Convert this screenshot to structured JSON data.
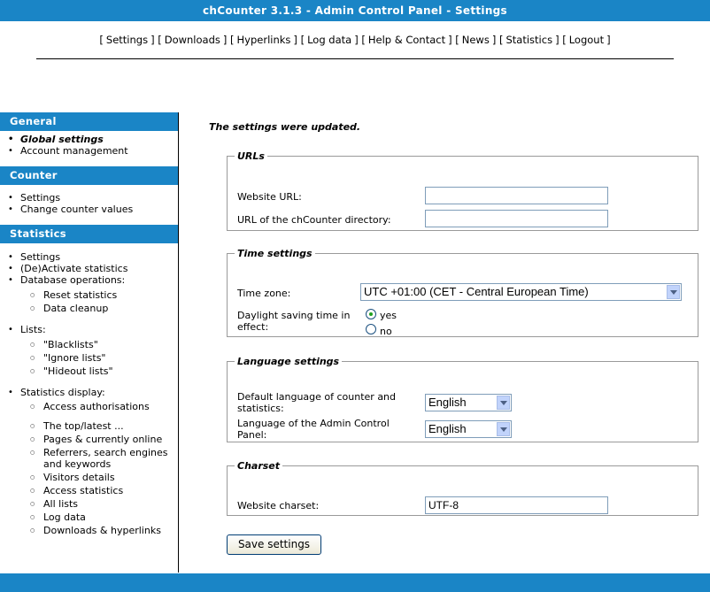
{
  "title": "chCounter 3.1.3 - Admin Control Panel - Settings",
  "topnav": [
    "Settings",
    "Downloads",
    "Hyperlinks",
    "Log data",
    "Help & Contact",
    "News",
    "Statistics",
    "Logout"
  ],
  "sidebar": {
    "general": {
      "title": "General",
      "items": [
        "Global settings",
        "Account management"
      ]
    },
    "counter": {
      "title": "Counter",
      "items": [
        "Settings",
        "Change counter values"
      ]
    },
    "statistics": {
      "title": "Statistics",
      "items": [
        "Settings",
        "(De)Activate statistics",
        "Database operations:"
      ],
      "dbops": [
        "Reset statistics",
        "Data cleanup"
      ],
      "lists_label": "Lists:",
      "lists": [
        "\"Blacklists\"",
        "\"Ignore lists\"",
        "\"Hideout lists\""
      ],
      "display_label": "Statistics display:",
      "display_auth": "Access authorisations",
      "display": [
        "The top/latest ...",
        "Pages & currently online",
        "Referrers, search engines and keywords",
        "Visitors details",
        "Access statistics",
        "All lists",
        "Log data",
        "Downloads & hyperlinks"
      ]
    }
  },
  "message": "The settings were updated.",
  "urls": {
    "legend": "URLs",
    "website_label": "Website URL:",
    "website_value": "",
    "dir_label": "URL of the chCounter directory:",
    "dir_value": ""
  },
  "time": {
    "legend": "Time settings",
    "tz_label": "Time zone:",
    "tz_value": "UTC +01:00 (CET - Central European Time)",
    "dst_label": "Daylight saving time in effect:",
    "yes": "yes",
    "no": "no"
  },
  "language": {
    "legend": "Language settings",
    "counter_label": "Default language of counter and statistics:",
    "counter_value": "English",
    "acp_label": "Language of the Admin Control Panel:",
    "acp_value": "English"
  },
  "charset": {
    "legend": "Charset",
    "label": "Website charset:",
    "value": "UTF-8"
  },
  "save_label": "Save settings"
}
